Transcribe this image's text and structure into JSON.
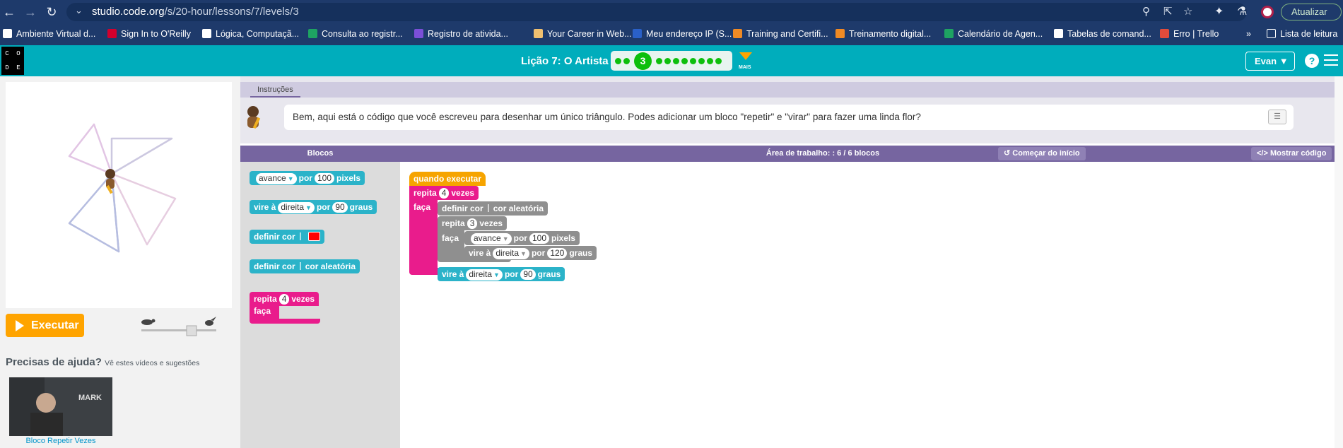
{
  "browser": {
    "url_host": "studio.code.org",
    "url_path": "/s/20-hour/lessons/7/levels/3",
    "update_label": "Atualizar"
  },
  "bookmarks": [
    {
      "label": "Ambiente Virtual d...",
      "color": "#ffffff"
    },
    {
      "label": "Sign In to O'Reilly",
      "color": "#d3002d"
    },
    {
      "label": "Lógica, Computaçã...",
      "color": "#ffffff"
    },
    {
      "label": "Consulta ao registr...",
      "color": "#1ea362"
    },
    {
      "label": "Registro de ativida...",
      "color": "#7b4fd8"
    },
    {
      "label": "Your Career in Web...",
      "color": "#f0c070"
    },
    {
      "label": "Meu endereço IP (S...",
      "color": "#2a60c8"
    },
    {
      "label": "Training and Certifi...",
      "color": "#f08a24"
    },
    {
      "label": "Treinamento digital...",
      "color": "#f08a24"
    },
    {
      "label": "Calendário de Agen...",
      "color": "#1ea362"
    },
    {
      "label": "Tabelas de comand...",
      "color": "#ffffff"
    },
    {
      "label": "Erro | Trello",
      "color": "#e14b3b"
    }
  ],
  "bookmarks_more": "»",
  "reading_list": "Lista de leitura",
  "header": {
    "lesson_title": "Lição 7: O Artista 2",
    "current_level": "3",
    "mais_label": "MAIS",
    "user_label": "Evan",
    "logo_letters": [
      "C",
      "O",
      "D",
      "E"
    ]
  },
  "left": {
    "run_label": "Executar",
    "help_title": "Precisas de ajuda?",
    "help_sub": "Vê estes vídeos e sugestões",
    "video_caption": "Bloco Repetir Vezes",
    "video_overlay": "MARK"
  },
  "instructions": {
    "tab_label": "Instruções",
    "text": "Bem, aqui está o código que você escreveu para desenhar um único triângulo. Podes adicionar um bloco \"repetir\" e \"virar\" para fazer uma linda flor?"
  },
  "workspace": {
    "blocks_label": "Blocos",
    "title": "Área de trabalho: : 6 / 6 blocos",
    "restart_label": "Começar do início",
    "show_code_label": "Mostrar código"
  },
  "toolbox": {
    "move": {
      "verb": "avance",
      "prep": "por",
      "value": "100",
      "unit": "pixels"
    },
    "turn": {
      "verb": "vire à",
      "dir": "direita",
      "prep": "por",
      "value": "90",
      "unit": "graus"
    },
    "set_color": {
      "label": "definir cor",
      "color": "#ff0000"
    },
    "set_random": {
      "label": "definir cor",
      "value": "cor aleatória"
    },
    "repeat": {
      "label": "repita",
      "value": "4",
      "unit": "vezes",
      "do": "faça"
    }
  },
  "program": {
    "when_run": "quando executar",
    "repeat_outer": {
      "label": "repita",
      "value": "4",
      "unit": "vezes",
      "do": "faça"
    },
    "set_color": {
      "label": "definir cor",
      "value": "cor aleatória"
    },
    "repeat_inner": {
      "label": "repita",
      "value": "3",
      "unit": "vezes",
      "do": "faça"
    },
    "move": {
      "verb": "avance",
      "prep": "por",
      "value": "100",
      "unit": "pixels"
    },
    "turn_inner": {
      "verb": "vire à",
      "dir": "direita",
      "prep": "por",
      "value": "120",
      "unit": "graus"
    },
    "turn_outer": {
      "verb": "vire à",
      "dir": "direita",
      "prep": "por",
      "value": "90",
      "unit": "graus"
    }
  }
}
